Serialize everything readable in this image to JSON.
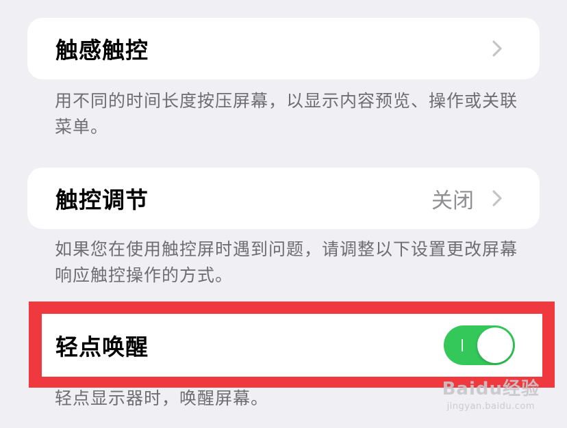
{
  "haptic_touch": {
    "label": "触感触控",
    "description": "用不同的时间长度按压屏幕，以显示内容预览、操作或关联菜单。"
  },
  "touch_accommodations": {
    "label": "触控调节",
    "value": "关闭",
    "description": "如果您在使用触控屏时遇到问题，请调整以下设置更改屏幕响应触控操作的方式。"
  },
  "tap_to_wake": {
    "label": "轻点唤醒",
    "toggle_on": true,
    "description": "轻点显示器时，唤醒屏幕。"
  },
  "watermark": {
    "main": "Baidu经验",
    "sub": "jingyan.baidu.com"
  },
  "colors": {
    "background": "#efeff4",
    "toggle_on": "#34c759",
    "highlight_border": "#f0393f",
    "secondary_text": "#6d6d72"
  }
}
